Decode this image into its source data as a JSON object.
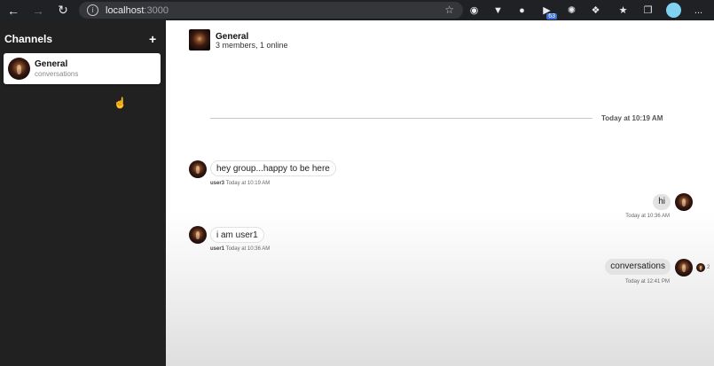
{
  "browser": {
    "url_host": "localhost",
    "url_port": ":3000",
    "info_icon": "i",
    "extension_badge": "63",
    "menu_label": "..."
  },
  "sidebar": {
    "title": "Channels",
    "add_label": "+",
    "channels": [
      {
        "name": "General",
        "subtitle": "conversations"
      }
    ]
  },
  "header": {
    "name": "General",
    "status": "3 members, 1 online"
  },
  "chat": {
    "divider_label": "Today at 10:19 AM",
    "messages": [
      {
        "direction": "incoming",
        "text": "hey group...happy to be here",
        "user": "user3",
        "time": "Today at 10:19 AM"
      },
      {
        "direction": "outgoing",
        "text": "hi",
        "user": "",
        "time": "Today at 10:36 AM"
      },
      {
        "direction": "incoming",
        "text": "i am user1",
        "user": "user1",
        "time": "Today at 10:36 AM"
      },
      {
        "direction": "outgoing",
        "text": "conversations",
        "user": "",
        "time": "Today at 12:41 PM",
        "read_count": "2"
      }
    ]
  },
  "colors": {
    "sidebar_bg": "#212121",
    "chrome_bg": "#202124",
    "outgoing_bubble": "#e3e3e3"
  }
}
